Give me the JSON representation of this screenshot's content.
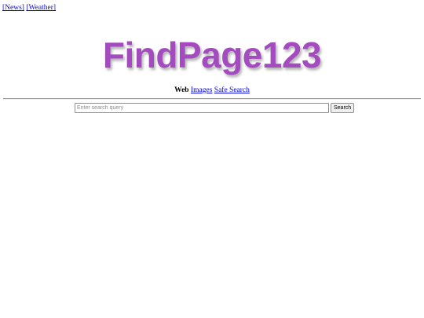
{
  "top_links": [
    {
      "label": "[News]"
    },
    {
      "label": "[Weather]"
    }
  ],
  "logo": {
    "text": "FindPage123",
    "color": "#a44cbf"
  },
  "nav": {
    "current": "Web",
    "links": [
      {
        "label": "Images"
      },
      {
        "label": "Safe Search"
      }
    ]
  },
  "search": {
    "value": "",
    "placeholder": "Enter search query",
    "button_label": "Search"
  },
  "colors": {
    "link": "#0000ee"
  }
}
